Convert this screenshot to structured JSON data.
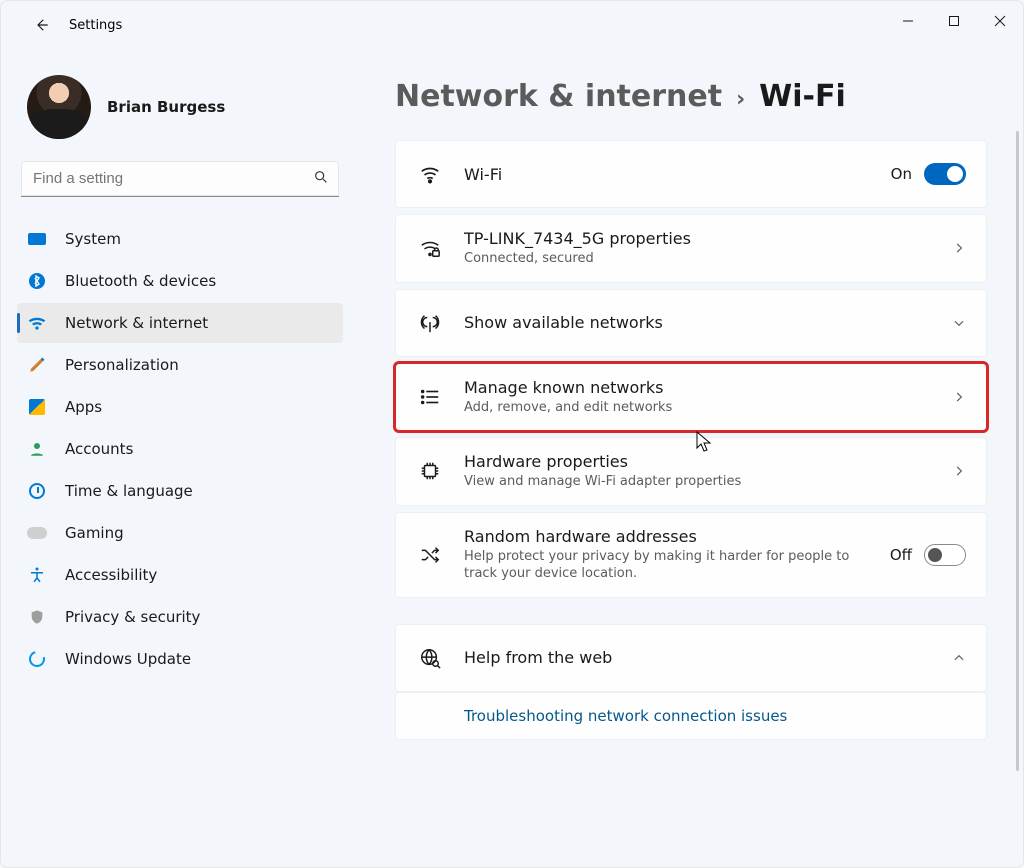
{
  "app": {
    "title": "Settings"
  },
  "profile": {
    "name": "Brian Burgess"
  },
  "search": {
    "placeholder": "Find a setting"
  },
  "sidebar": {
    "items": [
      {
        "label": "System"
      },
      {
        "label": "Bluetooth & devices"
      },
      {
        "label": "Network & internet"
      },
      {
        "label": "Personalization"
      },
      {
        "label": "Apps"
      },
      {
        "label": "Accounts"
      },
      {
        "label": "Time & language"
      },
      {
        "label": "Gaming"
      },
      {
        "label": "Accessibility"
      },
      {
        "label": "Privacy & security"
      },
      {
        "label": "Windows Update"
      }
    ]
  },
  "breadcrumb": {
    "parent": "Network & internet",
    "current": "Wi-Fi"
  },
  "cards": {
    "wifi": {
      "title": "Wi-Fi",
      "state": "On"
    },
    "conn": {
      "title": "TP-LINK_7434_5G properties",
      "sub": "Connected, secured"
    },
    "avail": {
      "title": "Show available networks"
    },
    "known": {
      "title": "Manage known networks",
      "sub": "Add, remove, and edit networks"
    },
    "hw": {
      "title": "Hardware properties",
      "sub": "View and manage Wi-Fi adapter properties"
    },
    "rand": {
      "title": "Random hardware addresses",
      "sub": "Help protect your privacy by making it harder for people to track your device location.",
      "state": "Off"
    },
    "help": {
      "title": "Help from the web"
    },
    "helplink": "Troubleshooting network connection issues"
  }
}
